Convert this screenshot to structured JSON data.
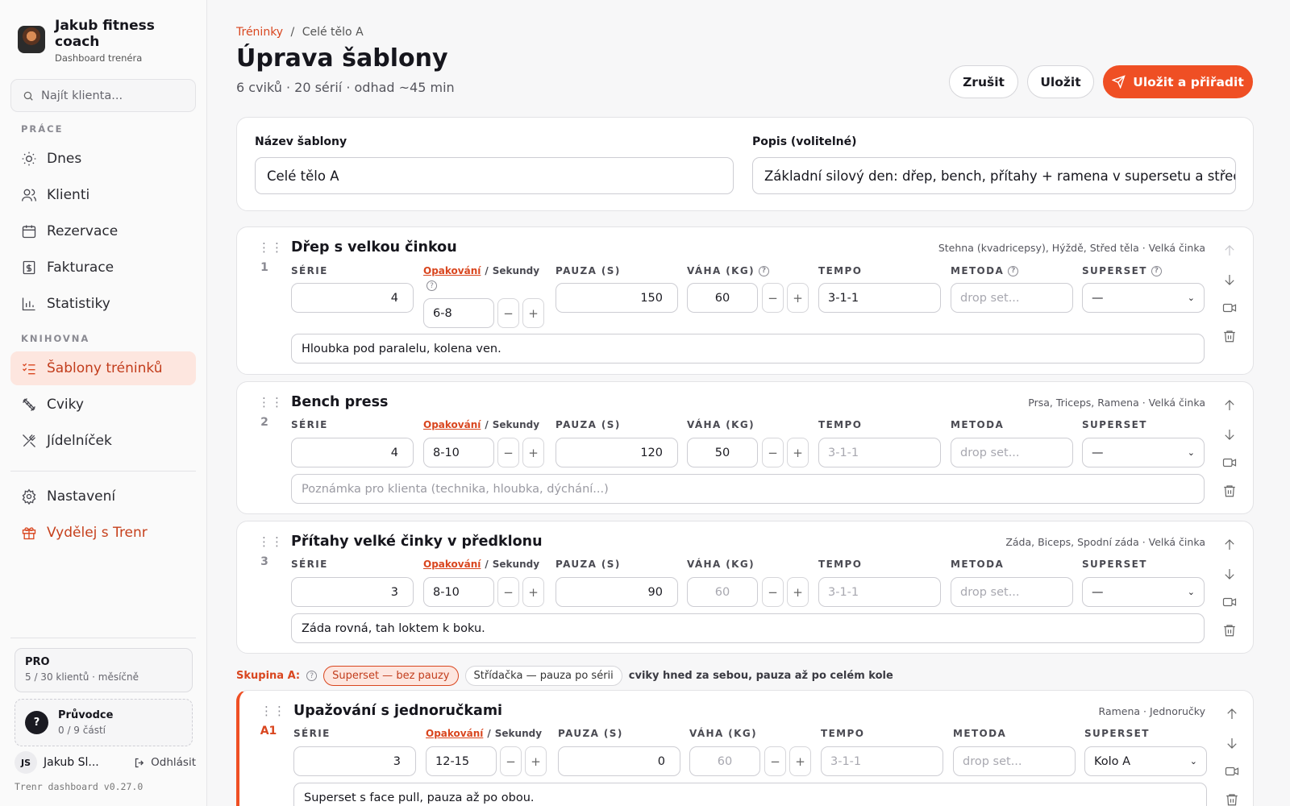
{
  "brand": {
    "name": "Jakub fitness coach",
    "subtitle": "Dashboard trenéra"
  },
  "search": {
    "placeholder": "Najít klienta..."
  },
  "nav": {
    "section_work": "PRÁCE",
    "section_library": "KNIHOVNA",
    "items": [
      {
        "label": "Dnes",
        "icon": "sun-icon"
      },
      {
        "label": "Klienti",
        "icon": "users-icon"
      },
      {
        "label": "Rezervace",
        "icon": "calendar-icon"
      },
      {
        "label": "Fakturace",
        "icon": "invoice-icon"
      },
      {
        "label": "Statistiky",
        "icon": "bar-chart-icon"
      },
      {
        "label": "Šablony tréninků",
        "icon": "checklist-icon",
        "active": true
      },
      {
        "label": "Cviky",
        "icon": "dumbbell-icon"
      },
      {
        "label": "Jídelníček",
        "icon": "utensils-icon"
      },
      {
        "label": "Nastavení",
        "icon": "gear-icon"
      },
      {
        "label": "Vydělej s Trenr",
        "icon": "gift-icon"
      }
    ]
  },
  "plan": {
    "name": "PRO",
    "detail": "5 / 30 klientů · měsíčně"
  },
  "guide": {
    "title": "Průvodce",
    "progress": "0 / 9 částí"
  },
  "user": {
    "initials": "JS",
    "name": "Jakub Sl...",
    "logout": "Odhlásit"
  },
  "version": "Trenr dashboard v0.27.0",
  "breadcrumb": {
    "parent": "Tréninky",
    "separator": "/",
    "current": "Celé tělo A"
  },
  "page": {
    "title": "Úprava šablony",
    "summary": "6 cviků · 20 sérií · odhad ~45 min"
  },
  "actions": {
    "cancel": "Zrušit",
    "save": "Uložit",
    "save_assign": "Uložit a přiřadit"
  },
  "template": {
    "name_label": "Název šablony",
    "name_value": "Celé tělo A",
    "desc_label": "Popis (volitelné)",
    "desc_value": "Základní silový den: dřep, bench, přítahy + ramena v supersetu a střed těla"
  },
  "columns": {
    "series": "SÉRIE",
    "reps": "Opakování",
    "slash": "/",
    "seconds": "Sekundy",
    "rest": "PAUZA (S)",
    "weight": "VÁHA (KG)",
    "tempo": "TEMPO",
    "method": "METODA",
    "superset": "SUPERSET"
  },
  "exercises": [
    {
      "num": "1",
      "name": "Dřep s velkou činkou",
      "muscles": "Stehna (kvadricepsy), Hýždě, Střed těla · Velká činka",
      "series": "4",
      "reps": "6-8",
      "rest": "150",
      "weight": "60",
      "tempo": "3-1-1",
      "method": "drop set...",
      "superset": "—",
      "note": "Hloubka pod paralelu, kolena ven."
    },
    {
      "num": "2",
      "name": "Bench press",
      "muscles": "Prsa, Triceps, Ramena · Velká činka",
      "series": "4",
      "reps": "8-10",
      "rest": "120",
      "weight": "50",
      "tempo": "3-1-1",
      "method": "drop set...",
      "superset": "—",
      "note": "Poznámka pro klienta (technika, hloubka, dýchání...)"
    },
    {
      "num": "3",
      "name": "Přítahy velké činky v předklonu",
      "muscles": "Záda, Biceps, Spodní záda · Velká činka",
      "series": "3",
      "reps": "8-10",
      "rest": "90",
      "weight": "60",
      "tempo": "3-1-1",
      "method": "drop set...",
      "superset": "—",
      "note": "Záda rovná, tah loktem k boku."
    },
    {
      "num": "A1",
      "name": "Upažování s jednoručkami",
      "muscles": "Ramena · Jednoručky",
      "series": "3",
      "reps": "12-15",
      "rest": "0",
      "weight": "60",
      "tempo": "3-1-1",
      "method": "drop set...",
      "superset": "Kolo A",
      "note": "Superset s face pull, pauza až po obou."
    }
  ],
  "group": {
    "label": "Skupina A:",
    "mode_superset": "Superset — bez pauzy",
    "mode_alternate": "Střídačka — pauza po sérii",
    "description": "cviky hned za sebou, pauza až po celém kole"
  },
  "colors": {
    "accent": "#ef4f24",
    "accent_soft": "#fde6df"
  }
}
